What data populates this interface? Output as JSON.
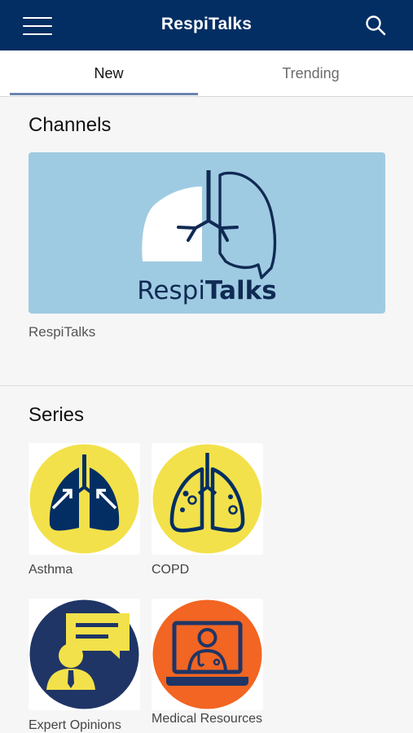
{
  "header": {
    "title": "RespiTalks",
    "menu_icon": "hamburger-menu-icon",
    "search_icon": "search-icon"
  },
  "tabs": [
    {
      "label": "New",
      "active": true
    },
    {
      "label": "Trending",
      "active": false
    }
  ],
  "channels": {
    "heading": "Channels",
    "items": [
      {
        "name": "RespiTalks",
        "logo_text_a": "Respi",
        "logo_text_b": "Talks"
      }
    ]
  },
  "series": {
    "heading": "Series",
    "items": [
      {
        "name": "Asthma",
        "icon": "asthma-lungs-icon"
      },
      {
        "name": "COPD",
        "icon": "copd-lungs-icon"
      },
      {
        "name": "Expert Opinions",
        "icon": "expert-speech-icon"
      },
      {
        "name": "Medical Resources",
        "icon": "doctor-screen-icon"
      }
    ]
  },
  "colors": {
    "navy": "#022e63",
    "yellow": "#f2e14a",
    "orange": "#f26522",
    "channel_bg": "#9fcbe2",
    "tab_indicator": "#6a86ad"
  }
}
